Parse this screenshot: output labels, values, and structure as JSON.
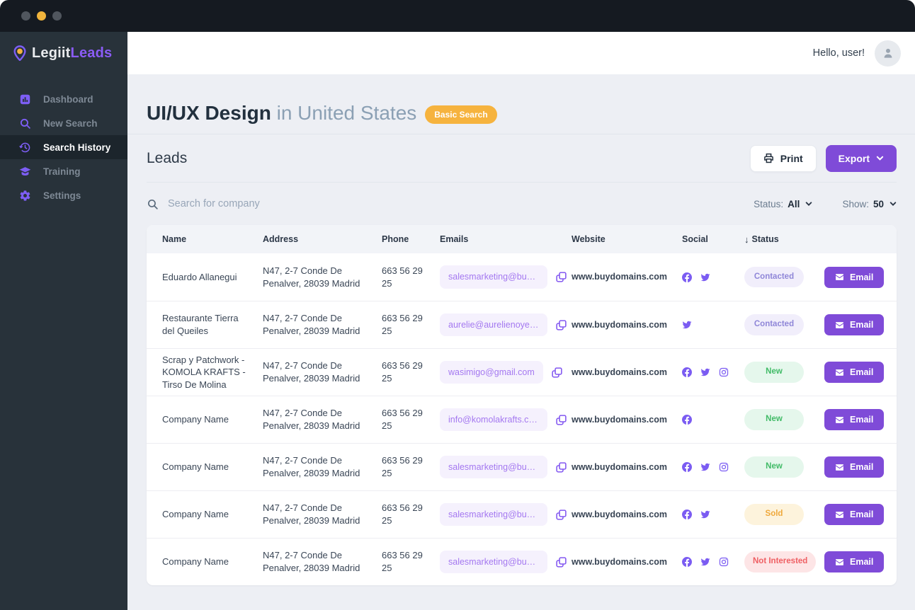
{
  "window": {
    "traffic_lights": [
      "gray",
      "yellow",
      "gray"
    ]
  },
  "sidebar": {
    "logo": {
      "primary": "Legiit",
      "secondary": "Leads"
    },
    "items": [
      {
        "label": "Dashboard",
        "icon": "dashboard-icon",
        "active": false
      },
      {
        "label": "New Search",
        "icon": "search-icon",
        "active": false
      },
      {
        "label": "Search History",
        "icon": "history-icon",
        "active": true
      },
      {
        "label": "Training",
        "icon": "training-icon",
        "active": false
      },
      {
        "label": "Settings",
        "icon": "settings-icon",
        "active": false
      }
    ]
  },
  "header": {
    "greeting": "Hello, user!"
  },
  "page": {
    "title_bold": "UI/UX Design",
    "title_rest": "in United States",
    "badge": "Basic Search",
    "section_title": "Leads",
    "print_label": "Print",
    "export_label": "Export"
  },
  "filters": {
    "search_placeholder": "Search for company",
    "status_label": "Status:",
    "status_value": "All",
    "show_label": "Show:",
    "show_value": "50"
  },
  "table": {
    "columns": [
      "Name",
      "Address",
      "Phone",
      "Emails",
      "Website",
      "Social",
      "Status"
    ],
    "sort_column": "Status",
    "sort_direction": "desc",
    "action_label": "Email",
    "rows": [
      {
        "name": "Eduardo Allanegui",
        "address": "N47, 2-7 Conde De Penalver, 28039 Madrid",
        "phone": "663 56 29 25",
        "email": "salesmarketing@buydom...",
        "website": "www.buydomains.com",
        "social": [
          "facebook",
          "twitter"
        ],
        "status": "Contacted"
      },
      {
        "name": "Restaurante Tierra del Queiles",
        "address": "N47, 2-7 Conde De Penalver, 28039 Madrid",
        "phone": "663 56 29 25",
        "email": "aurelie@aurelienoyer.com",
        "website": "www.buydomains.com",
        "social": [
          "twitter"
        ],
        "status": "Contacted"
      },
      {
        "name": "Scrap y Patchwork - KOMOLA KRAFTS - Tirso De Molina",
        "address": "N47, 2-7 Conde De Penalver, 28039 Madrid",
        "phone": "663 56 29 25",
        "email": "wasimigo@gmail.com",
        "website": "www.buydomains.com",
        "social": [
          "facebook",
          "twitter",
          "instagram"
        ],
        "status": "New"
      },
      {
        "name": "Company Name",
        "address": "N47, 2-7 Conde De Penalver, 28039 Madrid",
        "phone": "663 56 29 25",
        "email": "info@komolakrafts.com",
        "website": "www.buydomains.com",
        "social": [
          "facebook"
        ],
        "status": "New"
      },
      {
        "name": "Company Name",
        "address": "N47, 2-7 Conde De Penalver, 28039 Madrid",
        "phone": "663 56 29 25",
        "email": "salesmarketing@buydom...",
        "website": "www.buydomains.com",
        "social": [
          "facebook",
          "twitter",
          "instagram"
        ],
        "status": "New"
      },
      {
        "name": "Company Name",
        "address": "N47, 2-7 Conde De Penalver, 28039 Madrid",
        "phone": "663 56 29 25",
        "email": "salesmarketing@buydom...",
        "website": "www.buydomains.com",
        "social": [
          "facebook",
          "twitter"
        ],
        "status": "Sold"
      },
      {
        "name": "Company Name",
        "address": "N47, 2-7 Conde De Penalver, 28039 Madrid",
        "phone": "663 56 29 25",
        "email": "salesmarketing@buydom...",
        "website": "www.buydomains.com",
        "social": [
          "facebook",
          "twitter",
          "instagram"
        ],
        "status": "Not Interested"
      }
    ]
  },
  "colors": {
    "accent_purple": "#7f4bd8",
    "icon_purple": "#7b5cf2",
    "badge_amber": "#f6b33e",
    "status_contacted": "#8f86d8",
    "status_new": "#41bb67",
    "status_sold": "#efa93c",
    "status_not_interested": "#ef5f63",
    "sidebar_bg": "#28323a",
    "titlebar_bg": "#151a21",
    "main_bg": "#edeff4"
  }
}
